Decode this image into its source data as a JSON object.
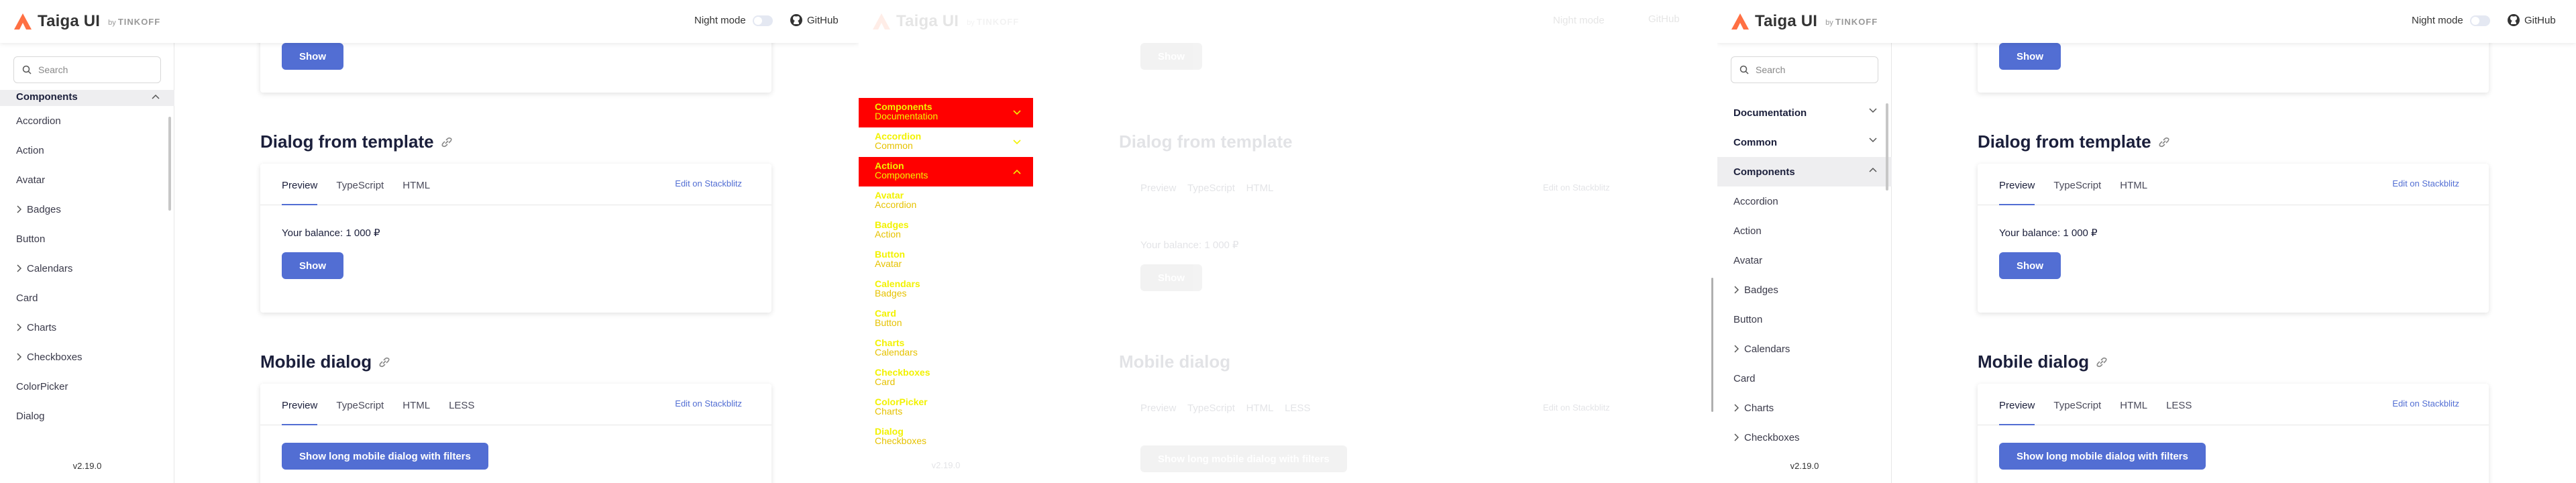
{
  "app": {
    "title": "Taiga UI",
    "by_prefix": "by",
    "by_brand": "TINKOFF",
    "night_mode": "Night mode",
    "github": "GitHub",
    "version": "v2.19.0",
    "accent": "#526ed3",
    "logo_color": "#ff7043"
  },
  "search": {
    "placeholder": "Search"
  },
  "sidebar_left": {
    "group": "Components",
    "items": [
      {
        "label": "Accordion",
        "sub": false
      },
      {
        "label": "Action",
        "sub": false
      },
      {
        "label": "Avatar",
        "sub": false
      },
      {
        "label": "Badges",
        "sub": true
      },
      {
        "label": "Button",
        "sub": false
      },
      {
        "label": "Calendars",
        "sub": true
      },
      {
        "label": "Card",
        "sub": false
      },
      {
        "label": "Charts",
        "sub": true
      },
      {
        "label": "Checkboxes",
        "sub": true
      },
      {
        "label": "ColorPicker",
        "sub": false
      },
      {
        "label": "Dialog",
        "sub": false
      }
    ]
  },
  "sidebar_right": {
    "groups": [
      "Documentation",
      "Common",
      "Components"
    ],
    "items": [
      {
        "label": "Accordion",
        "sub": false
      },
      {
        "label": "Action",
        "sub": false
      },
      {
        "label": "Avatar",
        "sub": false
      },
      {
        "label": "Badges",
        "sub": true
      },
      {
        "label": "Button",
        "sub": false
      },
      {
        "label": "Calendars",
        "sub": true
      },
      {
        "label": "Card",
        "sub": false
      },
      {
        "label": "Charts",
        "sub": true
      },
      {
        "label": "Checkboxes",
        "sub": true
      }
    ]
  },
  "overlay": {
    "items": [
      {
        "l1": "Components",
        "l2": "Documentation",
        "red": true
      },
      {
        "l1": "Accordion",
        "l2": "Common",
        "red": false
      },
      {
        "l1": "Action",
        "l2": "Components",
        "red": true
      },
      {
        "l1": "Avatar",
        "l2": "Accordion",
        "red": false
      },
      {
        "l1": "Badges",
        "l2": "Action",
        "red": false
      },
      {
        "l1": "Button",
        "l2": "Avatar",
        "red": false
      },
      {
        "l1": "Calendars",
        "l2": "Badges",
        "red": false
      },
      {
        "l1": "Card",
        "l2": "Button",
        "red": false
      },
      {
        "l1": "Charts",
        "l2": "Calendars",
        "red": false
      },
      {
        "l1": "Checkboxes",
        "l2": "Card",
        "red": false
      },
      {
        "l1": "ColorPicker",
        "l2": "Charts",
        "red": false
      },
      {
        "l1": "Dialog",
        "l2": "Checkboxes",
        "red": false
      }
    ]
  },
  "main": {
    "top_button": "Show",
    "dialog_template": {
      "title": "Dialog from template",
      "tabs": [
        "Preview",
        "TypeScript",
        "HTML"
      ],
      "stackblitz": "Edit on Stackblitz",
      "balance": "Your balance: 1 000 ₽",
      "button": "Show"
    },
    "mobile_dialog": {
      "title": "Mobile dialog",
      "tabs": [
        "Preview",
        "TypeScript",
        "HTML",
        "LESS"
      ],
      "stackblitz": "Edit on Stackblitz",
      "button": "Show long mobile dialog with filters"
    }
  }
}
